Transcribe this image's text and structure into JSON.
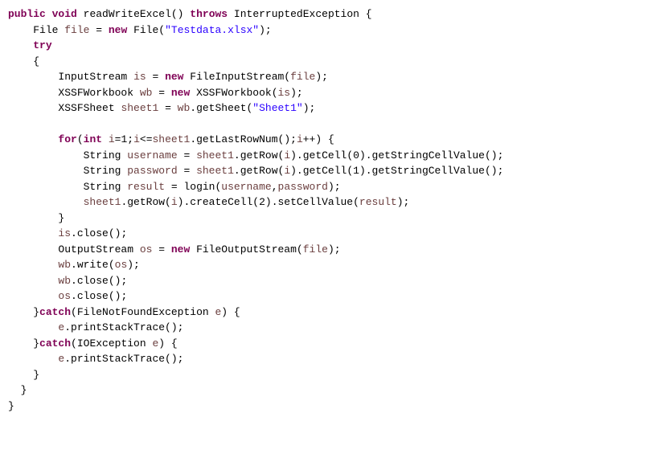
{
  "code": {
    "l1": {
      "kw1": "public",
      "kw2": "void",
      "method": "readWriteExcel()",
      "kw3": "throws",
      "exc": "InterruptedException {"
    },
    "l2": {
      "type": "File",
      "var": "file",
      "eq": " = ",
      "kw": "new",
      "rest": " File(",
      "str": "\"Testdata.xlsx\"",
      "end": ");"
    },
    "l3": {
      "kw": "try"
    },
    "l4": {
      "brace": "{"
    },
    "l5": {
      "type": "InputStream",
      "var": "is",
      "eq": " = ",
      "kw": "new",
      "rest": " FileInputStream(",
      "arg": "file",
      "end": ");"
    },
    "l6": {
      "type": "XSSFWorkbook",
      "var": "wb",
      "eq": " = ",
      "kw": "new",
      "rest": " XSSFWorkbook(",
      "arg": "is",
      "end": ");"
    },
    "l7": {
      "type": "XSSFSheet",
      "var": "sheet1",
      "eq": " = ",
      "obj": "wb",
      "call": ".getSheet(",
      "str": "\"Sheet1\"",
      "end": ");"
    },
    "l8": {
      "kw1": "for",
      "open": "(",
      "kw2": "int",
      "var1": "i",
      "init": "=1;",
      "var2": "i",
      "cmp": "<=",
      "obj": "sheet1",
      "call": ".getLastRowNum();",
      "var3": "i",
      "inc": "++) {"
    },
    "l9": {
      "type": "String",
      "var": "username",
      "eq": " = ",
      "obj": "sheet1",
      "call1": ".getRow(",
      "arg1": "i",
      "call2": ").getCell(0).getStringCellValue();"
    },
    "l10": {
      "type": "String",
      "var": "password",
      "eq": " = ",
      "obj": "sheet1",
      "call1": ".getRow(",
      "arg1": "i",
      "call2": ").getCell(1).getStringCellValue();"
    },
    "l11": {
      "type": "String",
      "var": "result",
      "eq": " = login(",
      "arg1": "username",
      "comma": ",",
      "arg2": "password",
      "end": ");"
    },
    "l12": {
      "obj": "sheet1",
      "call1": ".getRow(",
      "arg1": "i",
      "call2": ").createCell(2).setCellValue(",
      "arg2": "result",
      "end": ");"
    },
    "l13": {
      "brace": "}"
    },
    "l14": {
      "obj": "is",
      "call": ".close();"
    },
    "l15": {
      "type": "OutputStream",
      "var": "os",
      "eq": " = ",
      "kw": "new",
      "rest": " FileOutputStream(",
      "arg": "file",
      "end": ");"
    },
    "l16": {
      "obj": "wb",
      "call": ".write(",
      "arg": "os",
      "end": ");"
    },
    "l17": {
      "obj": "wb",
      "call": ".close();"
    },
    "l18": {
      "obj": "os",
      "call": ".close();"
    },
    "l19": {
      "brace": "}",
      "kw": "catch",
      "rest": "(FileNotFoundException ",
      "var": "e",
      "end": ") {"
    },
    "l20": {
      "obj": "e",
      "call": ".printStackTrace();"
    },
    "l21": {
      "brace": "}",
      "kw": "catch",
      "rest": "(IOException ",
      "var": "e",
      "end": ") {"
    },
    "l22": {
      "obj": "e",
      "call": ".printStackTrace();"
    },
    "l23": {
      "brace": "}"
    },
    "l24": {
      "brace": "}"
    },
    "l25": {
      "brace": "}"
    }
  }
}
